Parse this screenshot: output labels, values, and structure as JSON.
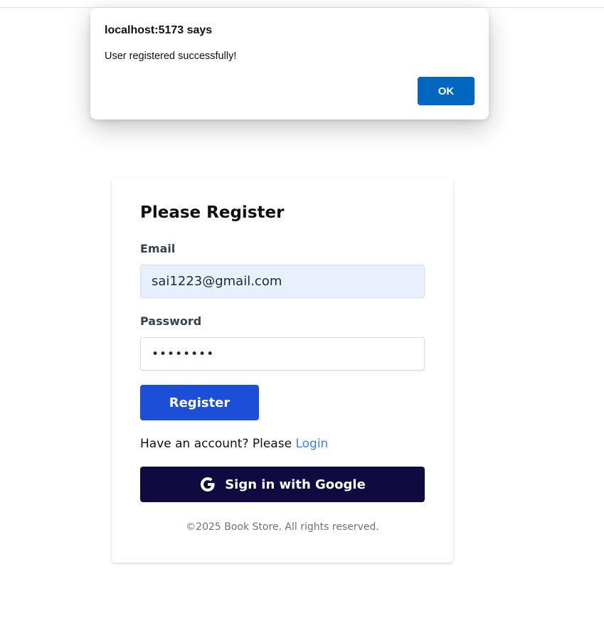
{
  "dialog": {
    "title": "localhost:5173 says",
    "message": "User registered successfully!",
    "ok_label": "OK"
  },
  "register": {
    "title": "Please Register",
    "email_label": "Email",
    "email_value": "sai1223@gmail.com",
    "password_label": "Password",
    "password_value": "••••••••",
    "submit_label": "Register",
    "account_prompt": "Have an account? Please ",
    "login_link": "Login",
    "google_label": "Sign in with Google",
    "google_icon": "google-icon",
    "copyright": "©2025 Book Store. All rights reserved."
  },
  "colors": {
    "primary_button": "#1d4ed8",
    "google_button": "#0f0a40",
    "link": "#3b82f6",
    "autofill_bg": "#e8f0fe",
    "dialog_ok": "#0067c0"
  }
}
